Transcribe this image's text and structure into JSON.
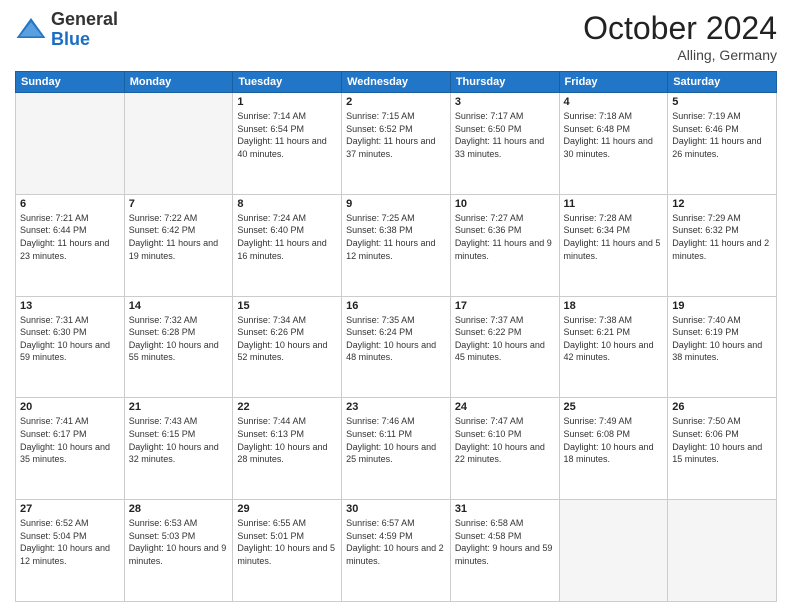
{
  "header": {
    "logo": {
      "general": "General",
      "blue": "Blue"
    },
    "title": "October 2024",
    "location": "Alling, Germany"
  },
  "days_of_week": [
    "Sunday",
    "Monday",
    "Tuesday",
    "Wednesday",
    "Thursday",
    "Friday",
    "Saturday"
  ],
  "weeks": [
    [
      {
        "day": "",
        "empty": true
      },
      {
        "day": "",
        "empty": true
      },
      {
        "day": "1",
        "sunrise": "Sunrise: 7:14 AM",
        "sunset": "Sunset: 6:54 PM",
        "daylight": "Daylight: 11 hours and 40 minutes."
      },
      {
        "day": "2",
        "sunrise": "Sunrise: 7:15 AM",
        "sunset": "Sunset: 6:52 PM",
        "daylight": "Daylight: 11 hours and 37 minutes."
      },
      {
        "day": "3",
        "sunrise": "Sunrise: 7:17 AM",
        "sunset": "Sunset: 6:50 PM",
        "daylight": "Daylight: 11 hours and 33 minutes."
      },
      {
        "day": "4",
        "sunrise": "Sunrise: 7:18 AM",
        "sunset": "Sunset: 6:48 PM",
        "daylight": "Daylight: 11 hours and 30 minutes."
      },
      {
        "day": "5",
        "sunrise": "Sunrise: 7:19 AM",
        "sunset": "Sunset: 6:46 PM",
        "daylight": "Daylight: 11 hours and 26 minutes."
      }
    ],
    [
      {
        "day": "6",
        "sunrise": "Sunrise: 7:21 AM",
        "sunset": "Sunset: 6:44 PM",
        "daylight": "Daylight: 11 hours and 23 minutes."
      },
      {
        "day": "7",
        "sunrise": "Sunrise: 7:22 AM",
        "sunset": "Sunset: 6:42 PM",
        "daylight": "Daylight: 11 hours and 19 minutes."
      },
      {
        "day": "8",
        "sunrise": "Sunrise: 7:24 AM",
        "sunset": "Sunset: 6:40 PM",
        "daylight": "Daylight: 11 hours and 16 minutes."
      },
      {
        "day": "9",
        "sunrise": "Sunrise: 7:25 AM",
        "sunset": "Sunset: 6:38 PM",
        "daylight": "Daylight: 11 hours and 12 minutes."
      },
      {
        "day": "10",
        "sunrise": "Sunrise: 7:27 AM",
        "sunset": "Sunset: 6:36 PM",
        "daylight": "Daylight: 11 hours and 9 minutes."
      },
      {
        "day": "11",
        "sunrise": "Sunrise: 7:28 AM",
        "sunset": "Sunset: 6:34 PM",
        "daylight": "Daylight: 11 hours and 5 minutes."
      },
      {
        "day": "12",
        "sunrise": "Sunrise: 7:29 AM",
        "sunset": "Sunset: 6:32 PM",
        "daylight": "Daylight: 11 hours and 2 minutes."
      }
    ],
    [
      {
        "day": "13",
        "sunrise": "Sunrise: 7:31 AM",
        "sunset": "Sunset: 6:30 PM",
        "daylight": "Daylight: 10 hours and 59 minutes."
      },
      {
        "day": "14",
        "sunrise": "Sunrise: 7:32 AM",
        "sunset": "Sunset: 6:28 PM",
        "daylight": "Daylight: 10 hours and 55 minutes."
      },
      {
        "day": "15",
        "sunrise": "Sunrise: 7:34 AM",
        "sunset": "Sunset: 6:26 PM",
        "daylight": "Daylight: 10 hours and 52 minutes."
      },
      {
        "day": "16",
        "sunrise": "Sunrise: 7:35 AM",
        "sunset": "Sunset: 6:24 PM",
        "daylight": "Daylight: 10 hours and 48 minutes."
      },
      {
        "day": "17",
        "sunrise": "Sunrise: 7:37 AM",
        "sunset": "Sunset: 6:22 PM",
        "daylight": "Daylight: 10 hours and 45 minutes."
      },
      {
        "day": "18",
        "sunrise": "Sunrise: 7:38 AM",
        "sunset": "Sunset: 6:21 PM",
        "daylight": "Daylight: 10 hours and 42 minutes."
      },
      {
        "day": "19",
        "sunrise": "Sunrise: 7:40 AM",
        "sunset": "Sunset: 6:19 PM",
        "daylight": "Daylight: 10 hours and 38 minutes."
      }
    ],
    [
      {
        "day": "20",
        "sunrise": "Sunrise: 7:41 AM",
        "sunset": "Sunset: 6:17 PM",
        "daylight": "Daylight: 10 hours and 35 minutes."
      },
      {
        "day": "21",
        "sunrise": "Sunrise: 7:43 AM",
        "sunset": "Sunset: 6:15 PM",
        "daylight": "Daylight: 10 hours and 32 minutes."
      },
      {
        "day": "22",
        "sunrise": "Sunrise: 7:44 AM",
        "sunset": "Sunset: 6:13 PM",
        "daylight": "Daylight: 10 hours and 28 minutes."
      },
      {
        "day": "23",
        "sunrise": "Sunrise: 7:46 AM",
        "sunset": "Sunset: 6:11 PM",
        "daylight": "Daylight: 10 hours and 25 minutes."
      },
      {
        "day": "24",
        "sunrise": "Sunrise: 7:47 AM",
        "sunset": "Sunset: 6:10 PM",
        "daylight": "Daylight: 10 hours and 22 minutes."
      },
      {
        "day": "25",
        "sunrise": "Sunrise: 7:49 AM",
        "sunset": "Sunset: 6:08 PM",
        "daylight": "Daylight: 10 hours and 18 minutes."
      },
      {
        "day": "26",
        "sunrise": "Sunrise: 7:50 AM",
        "sunset": "Sunset: 6:06 PM",
        "daylight": "Daylight: 10 hours and 15 minutes."
      }
    ],
    [
      {
        "day": "27",
        "sunrise": "Sunrise: 6:52 AM",
        "sunset": "Sunset: 5:04 PM",
        "daylight": "Daylight: 10 hours and 12 minutes."
      },
      {
        "day": "28",
        "sunrise": "Sunrise: 6:53 AM",
        "sunset": "Sunset: 5:03 PM",
        "daylight": "Daylight: 10 hours and 9 minutes."
      },
      {
        "day": "29",
        "sunrise": "Sunrise: 6:55 AM",
        "sunset": "Sunset: 5:01 PM",
        "daylight": "Daylight: 10 hours and 5 minutes."
      },
      {
        "day": "30",
        "sunrise": "Sunrise: 6:57 AM",
        "sunset": "Sunset: 4:59 PM",
        "daylight": "Daylight: 10 hours and 2 minutes."
      },
      {
        "day": "31",
        "sunrise": "Sunrise: 6:58 AM",
        "sunset": "Sunset: 4:58 PM",
        "daylight": "Daylight: 9 hours and 59 minutes."
      },
      {
        "day": "",
        "empty": true
      },
      {
        "day": "",
        "empty": true
      }
    ]
  ]
}
